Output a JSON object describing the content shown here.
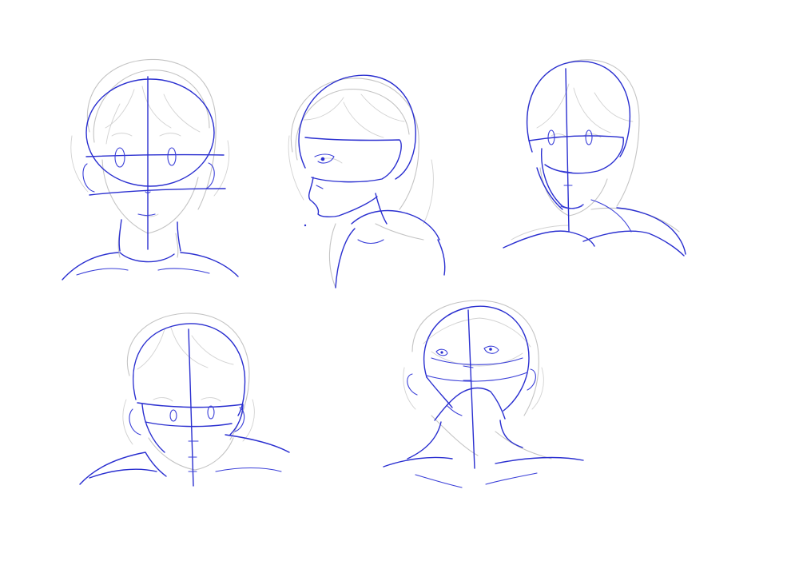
{
  "canvas": {
    "background": "#ffffff"
  },
  "colors": {
    "construction_blue": "#2a2fd0",
    "sketch_grey": "#c4c4c4"
  },
  "sketches": [
    {
      "pose": "front-view"
    },
    {
      "pose": "side-view-facing-left"
    },
    {
      "pose": "three-quarter-view-looking-down"
    },
    {
      "pose": "front-view-looking-down"
    },
    {
      "pose": "front-view-looking-up"
    }
  ]
}
